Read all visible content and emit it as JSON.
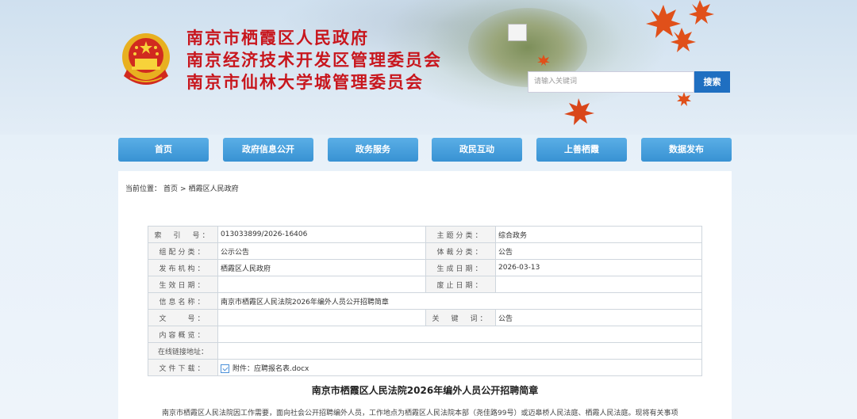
{
  "header": {
    "titles": [
      "南京市栖霞区人民政府",
      "南京经济技术开发区管理委员会",
      "南京市仙林大学城管理委员会"
    ]
  },
  "search": {
    "placeholder": "请输入关键词",
    "button": "搜索"
  },
  "nav": {
    "items": [
      "首页",
      "政府信息公开",
      "政务服务",
      "政民互动",
      "上善栖霞",
      "数据发布"
    ]
  },
  "breadcrumb": {
    "prefix": "当前位置：",
    "home": "首页",
    "sep": ">",
    "current": "栖霞区人民政府"
  },
  "meta": {
    "index_label": "索　引　号：",
    "index_value": "013033899/2026-16406",
    "topic_label": "主题分类：",
    "topic_value": "综合政务",
    "org_label": "组配分类：",
    "org_value": "公示公告",
    "genre_label": "体裁分类：",
    "genre_value": "公告",
    "issuer_label": "发布机构：",
    "issuer_value": "栖霞区人民政府",
    "created_label": "生成日期：",
    "created_value": "2026-03-13",
    "effective_label": "生效日期：",
    "effective_value": "",
    "expired_label": "废止日期：",
    "expired_value": "",
    "name_label": "信息名称：",
    "name_value": "南京市栖霞区人民法院2026年编外人员公开招聘简章",
    "docno_label": "文　　号：",
    "docno_value": "",
    "keyword_label": "关　键　词：",
    "keyword_value": "公告",
    "summary_label": "内容概览：",
    "summary_value": "",
    "link_label": "在线链接地址：",
    "link_value": "",
    "download_label": "文件下载：",
    "download_value": "附件：应聘报名表.docx"
  },
  "article": {
    "title": "南京市栖霞区人民法院2026年编外人员公开招聘简章",
    "body": "南京市栖霞区人民法院因工作需要，面向社会公开招聘编外人员，工作地点为栖霞区人民法院本部（尧佳路99号）或迈皋桥人民法庭、栖霞人民法庭。现将有关事项"
  },
  "colors": {
    "title_red": "#c8161d",
    "nav_blue": "#3892d3",
    "search_blue": "#1f6fc1"
  }
}
